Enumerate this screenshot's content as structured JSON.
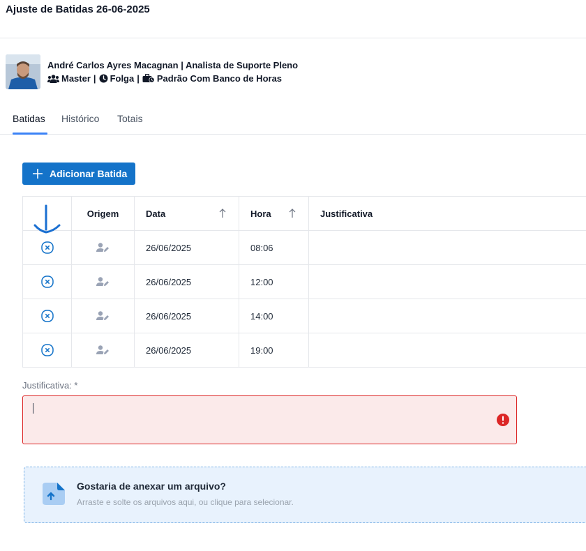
{
  "page": {
    "title": "Ajuste de Batidas 26-06-2025"
  },
  "user": {
    "name_role": "André Carlos Ayres Macagnan | Analista de Suporte Pleno",
    "group": "Master",
    "status": "Folga",
    "schedule": "Padrão Com Banco de Horas",
    "separator": "|"
  },
  "tabs": [
    {
      "label": "Batidas",
      "active": true
    },
    {
      "label": "Histórico",
      "active": false
    },
    {
      "label": "Totais",
      "active": false
    }
  ],
  "add_button": {
    "label": "Adicionar Batida"
  },
  "table": {
    "columns": [
      "",
      "Origem",
      "Data",
      "Hora",
      "Justificativa"
    ],
    "rows": [
      {
        "date": "26/06/2025",
        "time": "08:06",
        "justification": ""
      },
      {
        "date": "26/06/2025",
        "time": "12:00",
        "justification": ""
      },
      {
        "date": "26/06/2025",
        "time": "14:00",
        "justification": ""
      },
      {
        "date": "26/06/2025",
        "time": "19:00",
        "justification": ""
      }
    ]
  },
  "justification": {
    "label": "Justificativa: *",
    "value": ""
  },
  "dropzone": {
    "title": "Gostaria de anexar um arquivo?",
    "subtitle": "Arraste e solte os arquivos aqui, ou clique para selecionar."
  },
  "colors": {
    "primary": "#1473c9",
    "error": "#dc2626",
    "tab_accent": "#3b82f6",
    "dropzone_bg": "#e8f2fd"
  },
  "icons": [
    "users-icon",
    "clock-icon",
    "briefcase-clock-icon",
    "plus-icon",
    "remove-circle-icon",
    "user-edit-icon",
    "sort-up-icon",
    "error-icon",
    "file-upload-icon",
    "arrow-down-annotation"
  ]
}
